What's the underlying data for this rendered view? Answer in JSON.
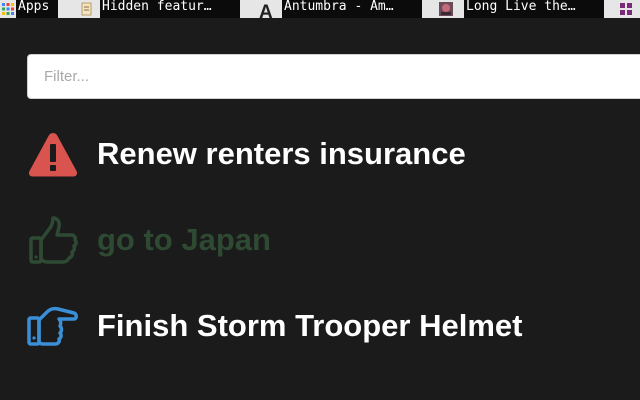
{
  "bookmarks": [
    {
      "icon": "apps-grid-icon",
      "label": "Apps"
    },
    {
      "icon": "document-icon",
      "label": "Hidden featur…"
    },
    {
      "icon": "letter-a-icon",
      "label": "Antumbra - Am…"
    },
    {
      "icon": "thumbnail-icon",
      "label": "Long Live the…"
    },
    {
      "icon": "purple-grid-icon",
      "label": ""
    }
  ],
  "filter": {
    "placeholder": "Filter...",
    "value": ""
  },
  "tasks": [
    {
      "label": "Renew renters insurance",
      "icon": "warning-icon",
      "color": "#ffffff",
      "icon_color": "#d9534f"
    },
    {
      "label": "go to Japan",
      "icon": "thumbs-up-icon",
      "color": "#2e4a33",
      "icon_color": "#2e4a33"
    },
    {
      "label": "Finish Storm Trooper Helmet",
      "icon": "hand-point-right-icon",
      "color": "#ffffff",
      "icon_color": "#3a8fd6"
    }
  ],
  "colors": {
    "background": "#1b1b1c",
    "warning": "#d9534f",
    "done": "#2e4a33",
    "in_progress": "#3a8fd6"
  }
}
